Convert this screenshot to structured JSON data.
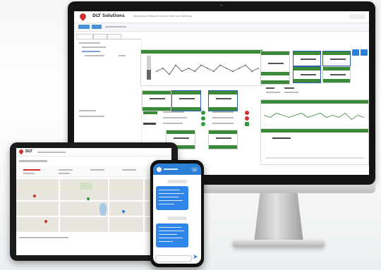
{
  "monitor": {
    "brand": "DLT Solutions",
    "menu": "Dashboard  Reports  Alerts  Devices  Settings",
    "chart_sample": [
      40,
      41,
      39,
      42,
      40,
      41,
      40,
      42,
      41,
      40,
      42,
      41,
      40,
      41,
      42,
      40,
      41
    ],
    "status_colors": {
      "ok": "#2e9b3a",
      "alarm": "#d32f2f",
      "header": "#3a8a3a",
      "accent": "#2c7fd6"
    }
  },
  "tablet": {
    "title": "DLT",
    "map_pins": [
      "pin-red",
      "pin-red",
      "pin-green",
      "pin-blue"
    ]
  },
  "phone": {
    "header_icon": "phone-icon",
    "send_icon": "send-icon"
  }
}
